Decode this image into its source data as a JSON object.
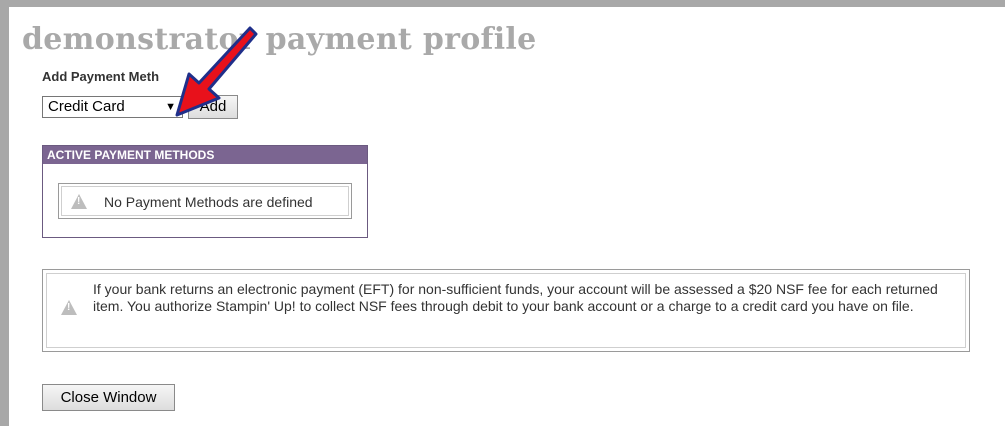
{
  "page": {
    "title": "demonstrator payment profile"
  },
  "add_payment": {
    "label": "Add Payment Meth",
    "select_value": "Credit Card",
    "select_arrow": "▼",
    "add_button": "Add"
  },
  "active_methods": {
    "header": "ACTIVE PAYMENT METHODS",
    "empty_message": "No Payment Methods are defined",
    "icon": "warning-icon"
  },
  "notice": {
    "text": "If your bank returns an electronic payment (EFT) for non-sufficient funds, your account will be assessed a $20 NSF fee for each returned item.  You authorize Stampin' Up! to collect NSF fees through debit to your bank account or a charge to a credit card you have on file.",
    "icon": "warning-icon"
  },
  "footer": {
    "close_button": "Close Window"
  },
  "annotation": {
    "arrow_color": "#e8111b",
    "arrow_outline": "#1f2f8a"
  },
  "colors": {
    "panel_header": "#7b6591",
    "title": "#a9a9a9"
  }
}
